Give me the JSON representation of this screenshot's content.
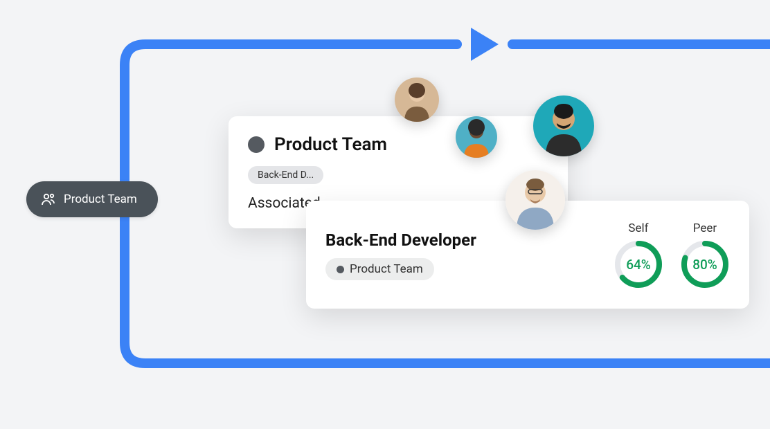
{
  "pill": {
    "label": "Product Team"
  },
  "team_card": {
    "title": "Product Team",
    "chip": "Back-End D...",
    "associated": "Associated"
  },
  "role_card": {
    "title": "Back-End Developer",
    "team": "Product Team",
    "metrics": {
      "self": {
        "label": "Self",
        "value": 64,
        "display": "64%"
      },
      "peer": {
        "label": "Peer",
        "value": 80,
        "display": "80%"
      }
    }
  },
  "colors": {
    "flow": "#3b82f6",
    "pill": "#4a5259",
    "ring": "#0f9d58",
    "ring_track": "#e5e7eb"
  }
}
